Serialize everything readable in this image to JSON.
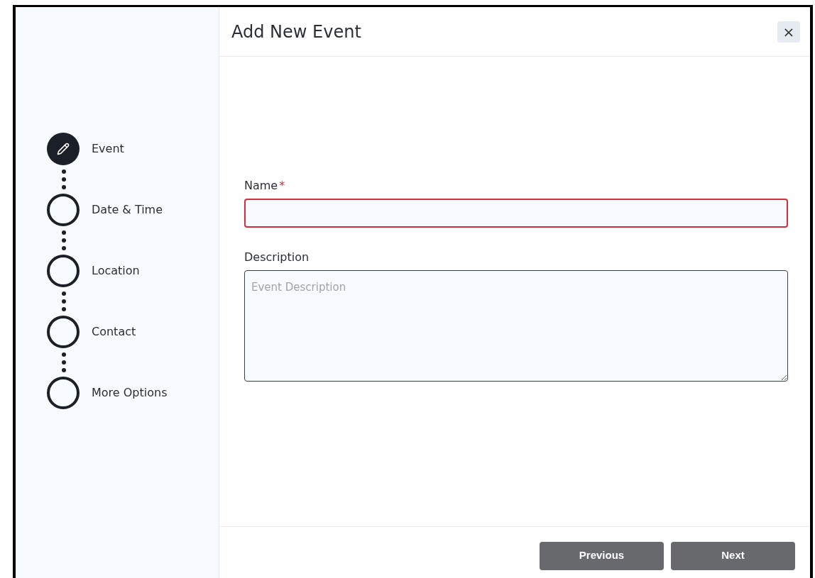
{
  "steps": [
    {
      "label": "Event",
      "selected": true
    },
    {
      "label": "Date & Time",
      "selected": false
    },
    {
      "label": "Location",
      "selected": false
    },
    {
      "label": "Contact",
      "selected": false
    },
    {
      "label": "More Options",
      "selected": false
    }
  ],
  "dialog": {
    "title": "Add New Event",
    "close": "×"
  },
  "form": {
    "name_label": "Name",
    "required_mark": "*",
    "name_invalid": true,
    "description_label": "Description",
    "description_placeholder": "Event Description"
  },
  "buttons": [
    "Previous",
    "Next"
  ]
}
